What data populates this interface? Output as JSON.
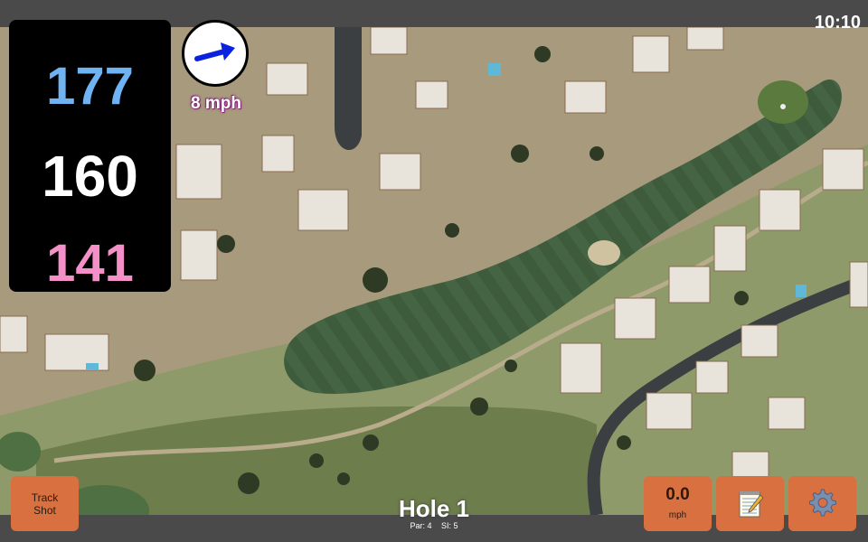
{
  "status_bar": {
    "time": "10:10"
  },
  "yardages": {
    "back": "177",
    "center": "160",
    "front": "141",
    "colors": {
      "back": "#6fb3f2",
      "center": "#ffffff",
      "front": "#f48fc8"
    }
  },
  "wind": {
    "speed_label": "8 mph",
    "direction_icon": "arrow-east-icon"
  },
  "buttons": {
    "track_shot_line1": "Track",
    "track_shot_line2": "Shot",
    "wind_value": "0.0",
    "wind_unit": "mph",
    "notes_icon": "notepad-icon",
    "settings_icon": "gear-icon",
    "accent_color": "#d97040"
  },
  "hole": {
    "title": "Hole 1",
    "par": "Par: 4",
    "si": "SI: 5"
  }
}
